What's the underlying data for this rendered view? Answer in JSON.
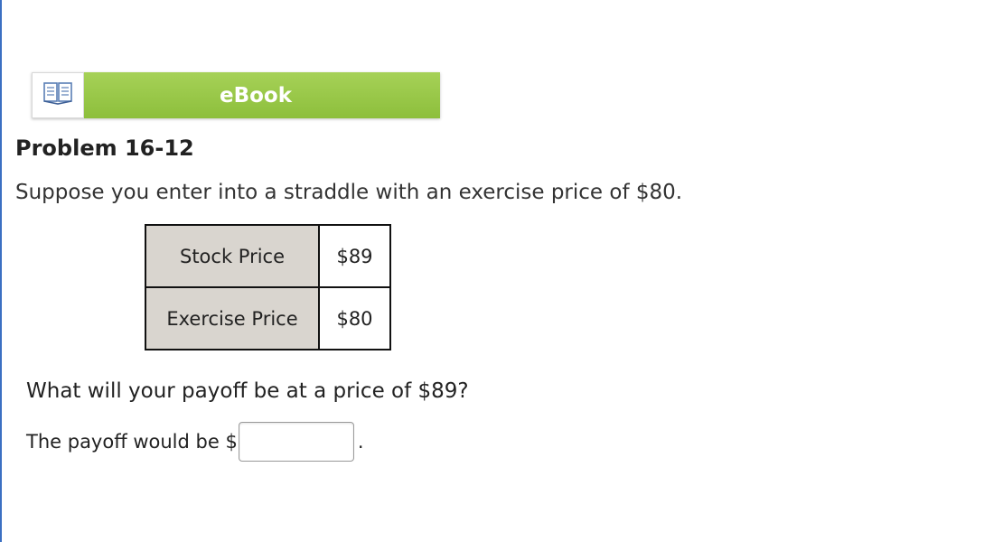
{
  "ebook": {
    "label": "eBook",
    "icon": "book-icon",
    "accent_color": "#8dbf3c"
  },
  "problem": {
    "title": "Problem 16-12",
    "description": "Suppose you enter into a straddle with an exercise price of $80."
  },
  "table": {
    "rows": [
      {
        "label": "Stock Price",
        "value": "$89"
      },
      {
        "label": "Exercise Price",
        "value": "$80"
      }
    ]
  },
  "question": {
    "text": "What will your payoff be at a price of $89?",
    "answer_prefix": "The payoff would be $",
    "answer_value": "",
    "answer_suffix": "."
  }
}
